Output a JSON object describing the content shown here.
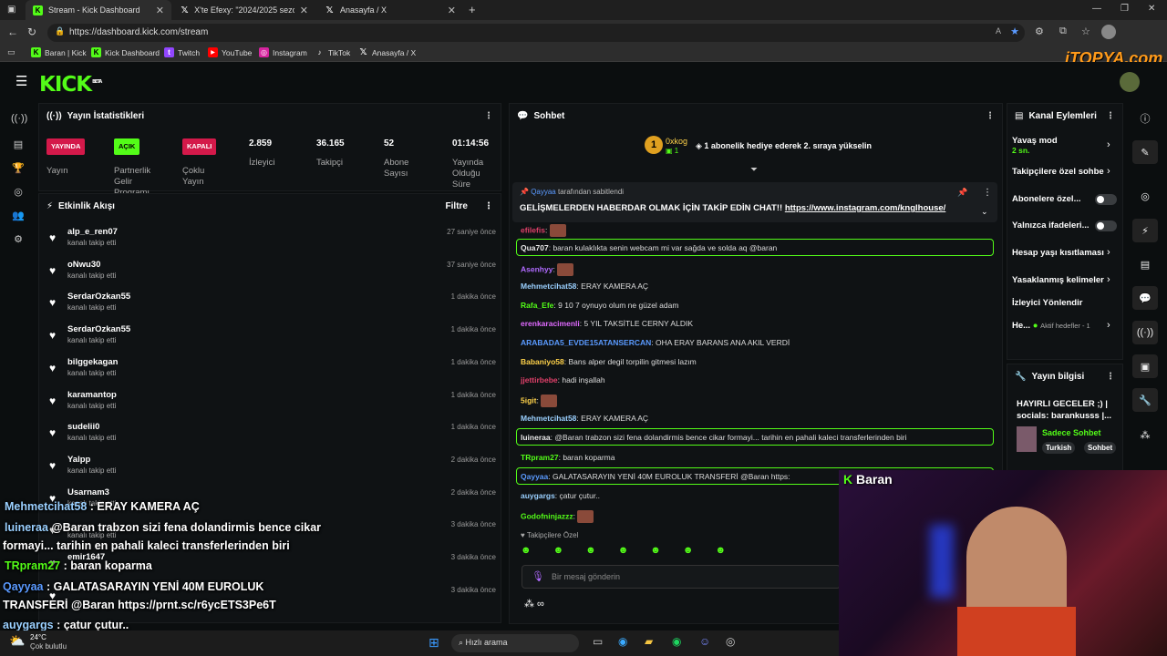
{
  "browser": {
    "tabs": [
      {
        "label": "Stream - Kick Dashboard",
        "icon": "kick-icon"
      },
      {
        "label": "X'te Efexy: \"2024/2025 sezonund",
        "icon": "x-icon"
      },
      {
        "label": "Anasayfa / X",
        "icon": "x-icon"
      }
    ],
    "url": "https://dashboard.kick.com/stream",
    "bookmarks": [
      "Baran | Kick",
      "Kick Dashboard",
      "Twitch",
      "YouTube",
      "Instagram",
      "TikTok",
      "Anasayfa / X"
    ]
  },
  "watermark": "iTOPYA.com",
  "logo": "KICK",
  "logo_beta": "BETA",
  "stats": {
    "title": "Yayın İstatistikleri",
    "items": [
      {
        "badge": "YAYINDA",
        "badge_color": "#d4194a",
        "label": "Yayın"
      },
      {
        "badge": "AÇIK",
        "badge_color": "#53fc18",
        "label": "Partnerlik Gelir Programı"
      },
      {
        "badge": "KAPALI",
        "badge_color": "#d4194a",
        "label": "Çoklu Yayın"
      },
      {
        "value": "2.859",
        "label": "İzleyici"
      },
      {
        "value": "36.165",
        "label": "Takipçi"
      },
      {
        "value": "52",
        "label": "Abone Sayısı"
      },
      {
        "value": "01:14:56",
        "label": "Yayında Olduğu Süre"
      }
    ]
  },
  "activity": {
    "title": "Etkinlik Akışı",
    "filter": "Filtre",
    "items": [
      {
        "name": "alp_e_ren07",
        "sub": "kanalı takip etti",
        "time": "27 saniye önce"
      },
      {
        "name": "oNwu30",
        "sub": "kanalı takip etti",
        "time": "37 saniye önce"
      },
      {
        "name": "SerdarOzkan55",
        "sub": "kanalı takip etti",
        "time": "1 dakika önce"
      },
      {
        "name": "SerdarOzkan55",
        "sub": "kanalı takip etti",
        "time": "1 dakika önce"
      },
      {
        "name": "bilggekagan",
        "sub": "kanalı takip etti",
        "time": "1 dakika önce"
      },
      {
        "name": "karamantop",
        "sub": "kanalı takip etti",
        "time": "1 dakika önce"
      },
      {
        "name": "sudelii0",
        "sub": "kanalı takip etti",
        "time": "1 dakika önce"
      },
      {
        "name": "Yalpp",
        "sub": "kanalı takip etti",
        "time": "2 dakika önce"
      },
      {
        "name": "Usarnam3",
        "sub": "kanalı takip etti",
        "time": "2 dakika önce"
      },
      {
        "name": "",
        "sub": "kanalı takip etti",
        "time": "3 dakika önce"
      },
      {
        "name": "emir1647",
        "sub": "",
        "time": "3 dakika önce"
      },
      {
        "name": "",
        "sub": "",
        "time": "3 dakika önce"
      }
    ]
  },
  "chat": {
    "title": "Sohbet",
    "gift_user": "0xkog",
    "gift_count": "1",
    "gift_text": "1 abonelik hediye ederek 2. sıraya yükselin",
    "pinned_by": "Qayyaa",
    "pinned_suffix": "tarafından sabitlendi",
    "pinned_msg": "GELİŞMELERDEN HABERDAR OLMAK İÇİN TAKİP EDİN CHAT!!",
    "pinned_link": "https://www.instagram.com/knglhouse/",
    "messages": [
      {
        "user": "efilefis",
        "color": "#e0406a",
        "text": ""
      },
      {
        "user": "Qua707",
        "color": "#e8e8e8",
        "text": "baran kulaklıkta senin webcam mi var sağda ve solda aq @baran",
        "hl": true
      },
      {
        "user": "Asenhyy",
        "color": "#b06aff",
        "text": ""
      },
      {
        "user": "Mehmetcihat58",
        "color": "#9ad0ff",
        "text": "ERAY KAMERA AÇ"
      },
      {
        "user": "Rafa_Efe",
        "color": "#53fc18",
        "text": "9 10 7 oynuyo olum ne güzel adam"
      },
      {
        "user": "erenkaracimenli",
        "color": "#e06aff",
        "text": "5 YIL TAKSİTLE CERNY ALDIK"
      },
      {
        "user": "ARABADA5_EVDE15ATANSERCAN",
        "color": "#5a9aff",
        "text": "OHA ERAY BARANS ANA AKIL VERDİ"
      },
      {
        "user": "Babaniyo58",
        "color": "#ffd24a",
        "text": "Bans alper degil torpilin gitmesi lazım"
      },
      {
        "user": "jjettirbebe",
        "color": "#e0406a",
        "text": "hadi inşallah"
      },
      {
        "user": "5igit",
        "color": "#ffd24a",
        "text": ""
      },
      {
        "user": "Mehmetcihat58",
        "color": "#9ad0ff",
        "text": "ERAY KAMERA AÇ"
      },
      {
        "user": "luineraa",
        "color": "#e8e8e8",
        "text": "@Baran trabzon sizi fena dolandirmis bence cikar formayi... tarihin en pahali kaleci transferlerinden biri",
        "hl": true
      },
      {
        "user": "TRpram27",
        "color": "#53fc18",
        "text": "baran koparma"
      },
      {
        "user": "Qayyaa",
        "color": "#5a9aff",
        "text": "GALATASARAYIN YENİ 40M EUROLUK TRANSFERİ @Baran https:",
        "hl": true
      },
      {
        "user": "auygargs",
        "color": "#9ad0ff",
        "text": "çatur çutur.."
      },
      {
        "user": "Godofninjazzz",
        "color": "#53fc18",
        "text": ""
      }
    ],
    "followers_only": "Takipçilere Özel",
    "placeholder": "Bir mesaj gönderin"
  },
  "channel": {
    "title": "Kanal Eylemleri",
    "slow_label": "Yavaş mod",
    "slow_val": "2 sn.",
    "items": [
      "Takipçilere özel sohbe",
      "Abonelere özel...",
      "Yalnızca ifadeleri...",
      "Hesap yaşı kısıtlaması",
      "Yasaklanmış kelimeler",
      "İzleyici Yönlendir",
      "He..."
    ],
    "goal_text": "Aktif hedefler - 1"
  },
  "streaminfo": {
    "title": "Yayın bilgisi",
    "stream_title": "HAYIRLI GECELER ;) | socials: barankusss |...",
    "category": "Sadece Sohbet",
    "tags": [
      "Turkish",
      "Sohbet"
    ]
  },
  "overlay": {
    "lines": [
      {
        "user": "Mehmetcihat58",
        "text": ": ERAY KAMERA AÇ"
      },
      {
        "user": "luineraa",
        "text": "@Baran trabzon sizi fena dolandirmis bence cikar"
      },
      {
        "user": "",
        "text": "formayi... tarihin en pahali kaleci transferlerinden biri"
      },
      {
        "user": "TRpram27",
        "text": ": baran koparma"
      },
      {
        "user": "Qayyaa",
        "text": ": GALATASARAYIN YENİ 40M EUROLUK"
      },
      {
        "user": "",
        "text": "TRANSFERİ @Baran https://prnt.sc/r6ycETS3Pe6T"
      },
      {
        "user": "auygargs",
        "text": ": çatur çutur.."
      }
    ],
    "cam_name": "Baran"
  },
  "taskbar": {
    "temp": "24°C",
    "weather": "Çok bulutlu",
    "search": "Hızlı arama"
  }
}
